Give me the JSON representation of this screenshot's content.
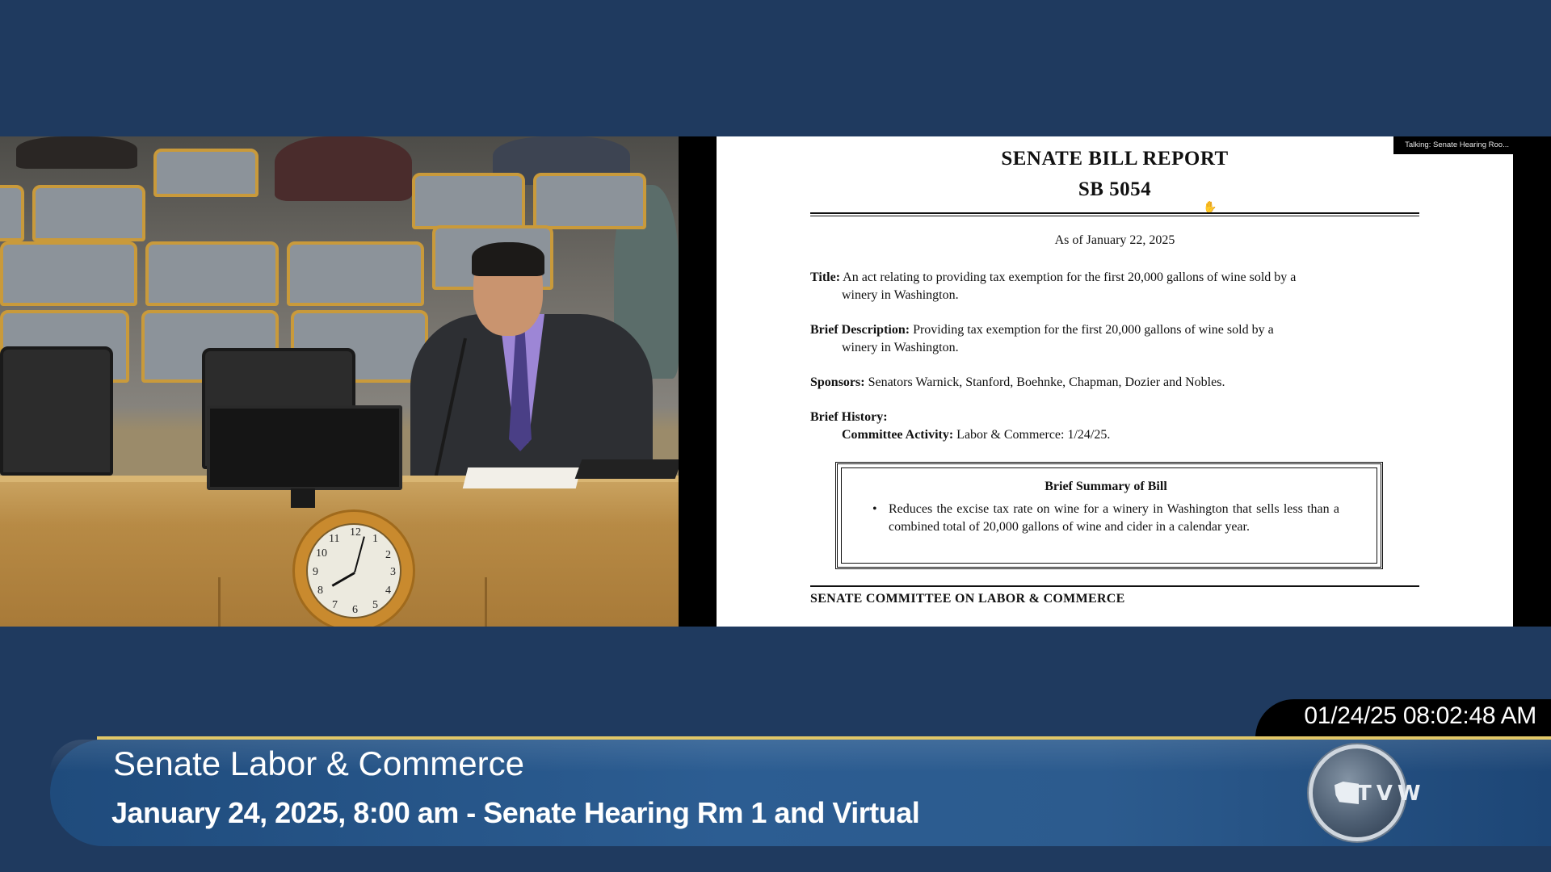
{
  "slide": {
    "talking_label": "Talking: Senate Hearing Roo...",
    "report_title": "SENATE BILL REPORT",
    "bill_number": "SB 5054",
    "as_of": "As of January 22, 2025",
    "title_lead": "Title:",
    "title_text": "An act relating to providing tax exemption for the first 20,000 gallons of wine sold by a",
    "title_cont": "winery in Washington.",
    "desc_lead": "Brief Description:",
    "desc_text": "Providing tax exemption for the first 20,000 gallons of wine sold by a",
    "desc_cont": "winery in Washington.",
    "sponsors_lead": "Sponsors:",
    "sponsors_text": "Senators Warnick, Stanford, Boehnke, Chapman, Dozier and Nobles.",
    "history_lead": "Brief History:",
    "committee_activity_lead": "Committee Activity:",
    "committee_activity_text": "Labor & Commerce: 1/24/25.",
    "summary_heading": "Brief Summary of Bill",
    "summary_bullet": "•",
    "summary_text": "Reduces the excise tax rate on wine for a winery in Washington that sells less than a combined total of 20,000 gallons of wine and cider in a calendar year.",
    "committee_footer": "SENATE COMMITTEE ON LABOR & COMMERCE"
  },
  "clock": {
    "numbers": [
      "12",
      "1",
      "2",
      "3",
      "4",
      "5",
      "6",
      "7",
      "8",
      "9",
      "10",
      "11"
    ]
  },
  "lower_third": {
    "timestamp": "01/24/25 08:02:48 AM",
    "title": "Senate Labor & Commerce",
    "subtitle": "January 24, 2025, 8:00 am - Senate Hearing Rm 1 and Virtual",
    "logo_text": "TVW"
  },
  "colors": {
    "background": "#1f3a5f",
    "banner": "#2c5d92",
    "accent_line": "#e1c768"
  }
}
